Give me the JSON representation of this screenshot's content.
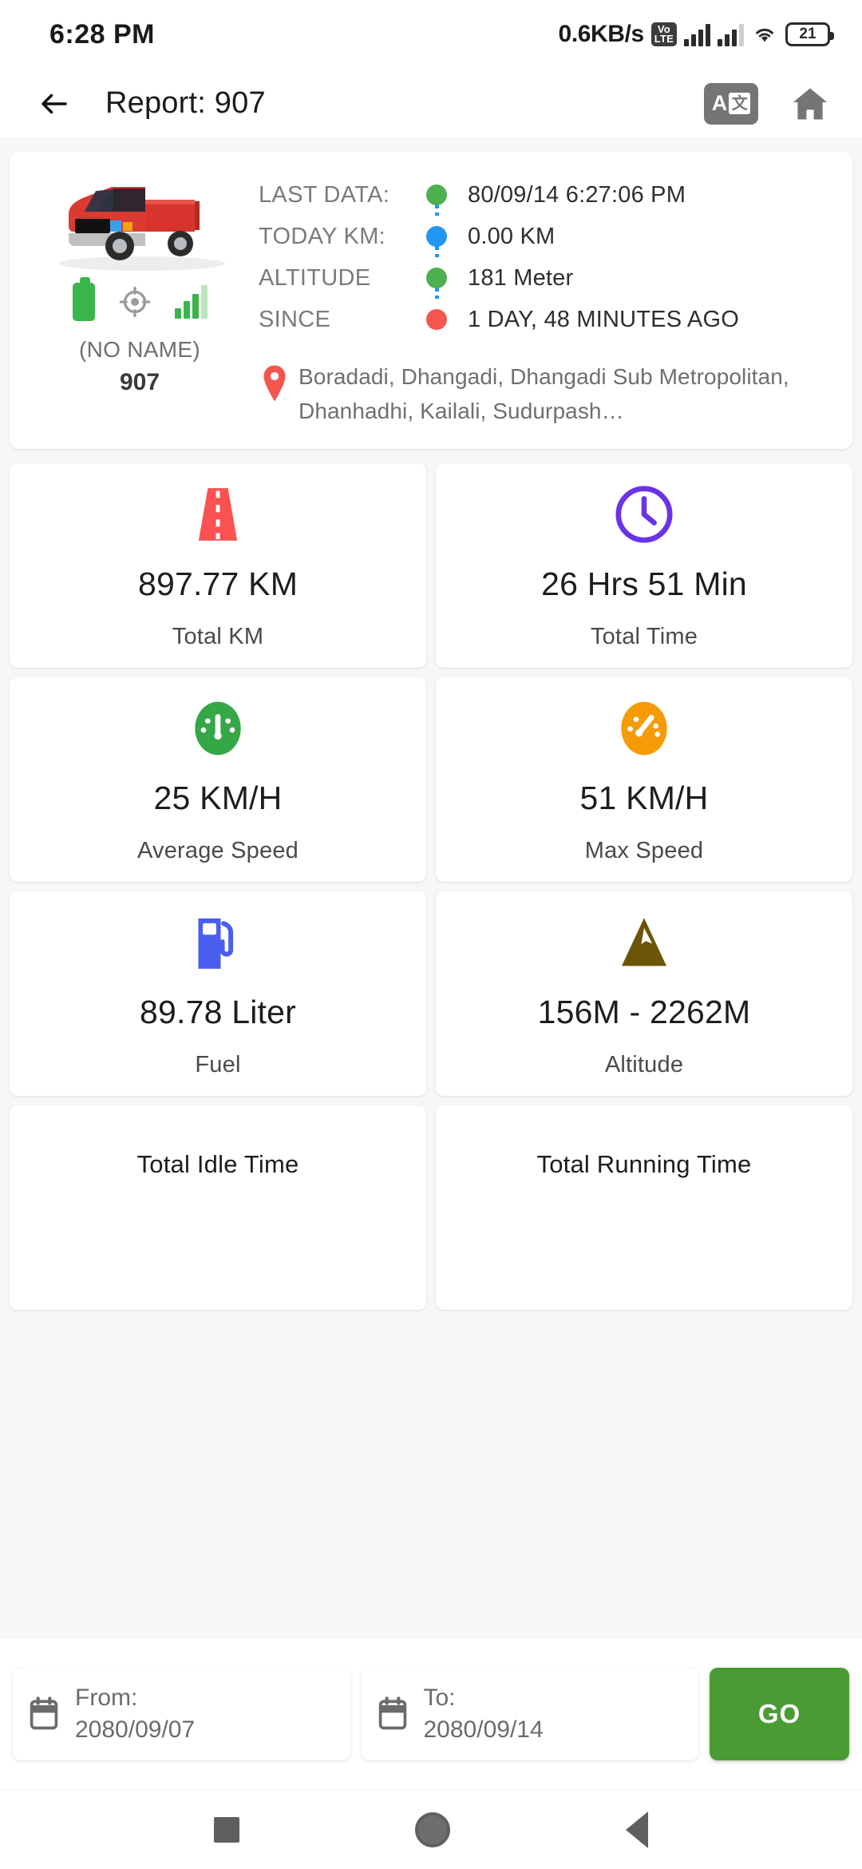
{
  "statusbar": {
    "time": "6:28 PM",
    "net_speed": "0.6KB/s",
    "volte_top": "Vo",
    "volte_bottom": "LTE",
    "battery": "21"
  },
  "appbar": {
    "title": "Report: 907",
    "back_icon": "arrow-left-icon",
    "translate_a": "A",
    "translate_glyph": "文",
    "home_icon": "home-icon"
  },
  "vehicle": {
    "name": "(NO NAME)",
    "id": "907",
    "labels": [
      "LAST DATA:",
      "TODAY KM:",
      "ALTITUDE",
      "SINCE"
    ],
    "values": [
      "80/09/14 6:27:06 PM",
      "0.00 KM",
      "181 Meter",
      "1 DAY, 48 MINUTES AGO"
    ],
    "dot_colors": [
      "#4caf50",
      "#2196f3",
      "#4caf50",
      "#f4564f"
    ],
    "address": "Boradadi, Dhangadi, Dhangadi Sub Metropolitan, Dhanhadhi, Kailali, Sudurpash…"
  },
  "stats": [
    {
      "icon": "road-icon",
      "color": "#fa5252",
      "value": "897.77 KM",
      "label": "Total KM"
    },
    {
      "icon": "clock-icon",
      "color": "#6a33e8",
      "value": "26 Hrs 51 Min",
      "label": "Total Time"
    },
    {
      "icon": "speedometer-icon",
      "color": "#35a747",
      "value": "25 KM/H",
      "label": "Average Speed"
    },
    {
      "icon": "speedometer-icon",
      "color": "#f59b08",
      "value": "51 KM/H",
      "label": "Max Speed"
    },
    {
      "icon": "fuel-pump-icon",
      "color": "#4a5ef0",
      "value": "89.78 Liter",
      "label": "Fuel"
    },
    {
      "icon": "mountain-icon",
      "color": "#6b5607",
      "value": "156M - 2262M",
      "label": "Altitude"
    },
    {
      "icon": "",
      "color": "",
      "value": "",
      "label": "Total Idle Time"
    },
    {
      "icon": "",
      "color": "",
      "value": "",
      "label": "Total Running Time"
    }
  ],
  "datebar": {
    "from_label": "From:",
    "from_value": "2080/09/07",
    "to_label": "To:",
    "to_value": "2080/09/14",
    "go_label": "GO",
    "calendar_icon": "calendar-icon"
  },
  "navbar": {
    "recents_icon": "square-recents-icon",
    "home_icon": "circle-home-icon",
    "back_icon": "triangle-back-icon"
  },
  "colors": {
    "background": "#f7f7f8",
    "card": "#ffffff",
    "accent_green": "#4a9b34",
    "text_primary": "#1d1d1d",
    "text_secondary": "#6f6f6f"
  }
}
